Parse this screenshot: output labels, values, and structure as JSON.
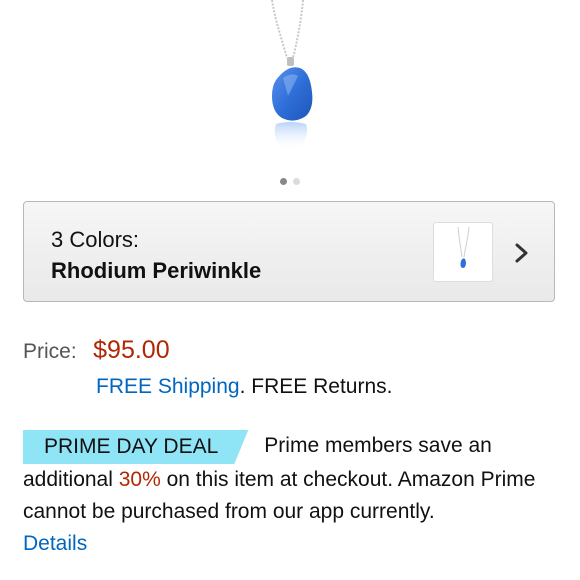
{
  "gallery": {
    "image_icon": "pendant-necklace-image",
    "dots_count": 2,
    "active_index": 0
  },
  "color_selector": {
    "count_label": "3 Colors:",
    "selected_color": "Rhodium Periwinkle",
    "chevron_icon": "chevron-right-icon"
  },
  "price": {
    "label": "Price:",
    "value": "$95.00"
  },
  "shipping": {
    "free_shipping_link": "FREE Shipping",
    "separator": ".",
    "free_returns": " FREE Returns."
  },
  "deal": {
    "badge": "PRIME DAY DEAL",
    "text_before": "Prime members save an additional ",
    "percent": "30%",
    "text_after": " on this item at checkout. Amazon Prime cannot be purchased from our app currently.",
    "details_link": "Details"
  },
  "colors": {
    "price_red": "#b12704",
    "link_blue": "#0066c0",
    "badge_cyan": "#8fe4f5",
    "pendant_blue": "#2f6fd8"
  }
}
